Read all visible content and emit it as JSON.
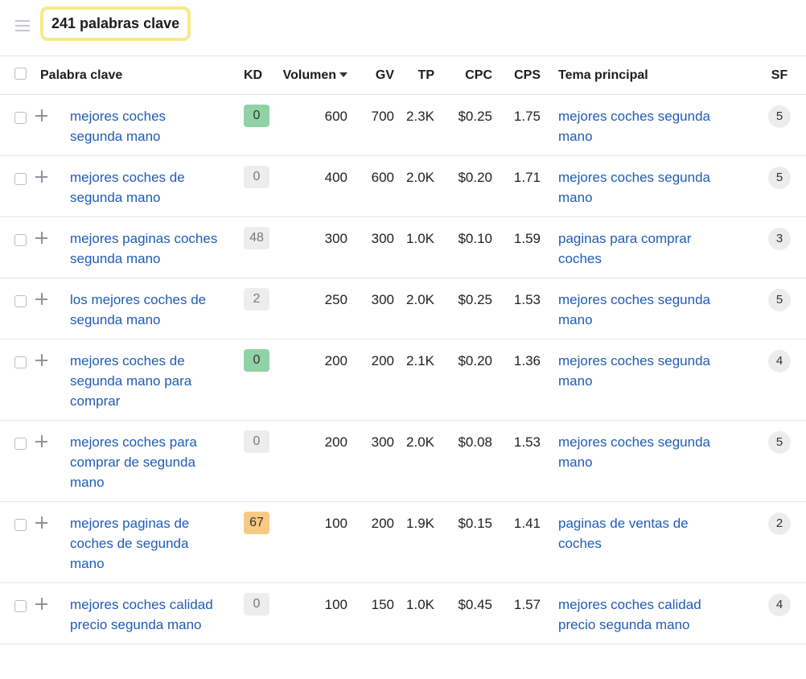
{
  "header": {
    "count_label": "241 palabras clave"
  },
  "columns": {
    "keyword": "Palabra clave",
    "kd": "KD",
    "volume": "Volumen",
    "gv": "GV",
    "tp": "TP",
    "cpc": "CPC",
    "cps": "CPS",
    "parent_topic": "Tema principal",
    "sf": "SF"
  },
  "sort": {
    "column": "volume",
    "direction": "desc",
    "icon": "caret-down-icon"
  },
  "kd_colors": {
    "green": "#8fd3a5",
    "gray": "#ededed",
    "orange": "#f8c983"
  },
  "rows": [
    {
      "keyword": "mejores coches segunda mano",
      "kd": "0",
      "kd_color": "green",
      "volume": "600",
      "gv": "700",
      "tp": "2.3K",
      "cpc": "$0.25",
      "cps": "1.75",
      "parent_topic": "mejores coches segunda mano",
      "sf": "5"
    },
    {
      "keyword": "mejores coches de segunda mano",
      "kd": "0",
      "kd_color": "gray",
      "volume": "400",
      "gv": "600",
      "tp": "2.0K",
      "cpc": "$0.20",
      "cps": "1.71",
      "parent_topic": "mejores coches segunda mano",
      "sf": "5"
    },
    {
      "keyword": "mejores paginas coches segunda mano",
      "kd": "48",
      "kd_color": "gray",
      "volume": "300",
      "gv": "300",
      "tp": "1.0K",
      "cpc": "$0.10",
      "cps": "1.59",
      "parent_topic": "paginas para comprar coches",
      "sf": "3"
    },
    {
      "keyword": "los mejores coches de segunda mano",
      "kd": "2",
      "kd_color": "gray",
      "volume": "250",
      "gv": "300",
      "tp": "2.0K",
      "cpc": "$0.25",
      "cps": "1.53",
      "parent_topic": "mejores coches segunda mano",
      "sf": "5"
    },
    {
      "keyword": "mejores coches de segunda mano para comprar",
      "kd": "0",
      "kd_color": "green",
      "volume": "200",
      "gv": "200",
      "tp": "2.1K",
      "cpc": "$0.20",
      "cps": "1.36",
      "parent_topic": "mejores coches segunda mano",
      "sf": "4"
    },
    {
      "keyword": "mejores coches para comprar de segunda mano",
      "kd": "0",
      "kd_color": "gray",
      "volume": "200",
      "gv": "300",
      "tp": "2.0K",
      "cpc": "$0.08",
      "cps": "1.53",
      "parent_topic": "mejores coches segunda mano",
      "sf": "5"
    },
    {
      "keyword": "mejores paginas de coches de segunda mano",
      "kd": "67",
      "kd_color": "orange",
      "volume": "100",
      "gv": "200",
      "tp": "1.9K",
      "cpc": "$0.15",
      "cps": "1.41",
      "parent_topic": "paginas de ventas de coches",
      "sf": "2"
    },
    {
      "keyword": "mejores coches calidad precio segunda mano",
      "kd": "0",
      "kd_color": "gray",
      "volume": "100",
      "gv": "150",
      "tp": "1.0K",
      "cpc": "$0.45",
      "cps": "1.57",
      "parent_topic": "mejores coches calidad precio segunda mano",
      "sf": "4"
    }
  ]
}
